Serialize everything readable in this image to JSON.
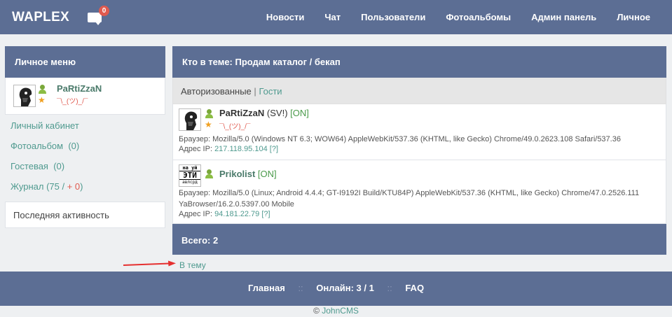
{
  "header": {
    "brand": "WAPLEX",
    "message_badge": "0",
    "nav": [
      "Новости",
      "Чат",
      "Пользователи",
      "Фотоальбомы",
      "Админ панель",
      "Личное"
    ]
  },
  "sidebar": {
    "title": "Личное меню",
    "user": {
      "name": "PaRtiZzaN",
      "status": "¯\\_(ツ)_/¯"
    },
    "menu": {
      "cabinet": "Личный кабинет",
      "photo_label": "Фотоальбом",
      "photo_count": "(0)",
      "guest_label": "Гостевая",
      "guest_count": "(0)",
      "journal_label": "Журнал",
      "journal_total": "(75 /",
      "journal_new": "+ 0",
      "journal_close": ")"
    },
    "last_activity": "Последняя активность"
  },
  "main": {
    "title": "Кто в теме: Продам каталог / бекап",
    "tabs": {
      "active": "Авторизованные",
      "separator": "|",
      "other": "Гости"
    },
    "users": [
      {
        "name": "PaRtiZzaN",
        "role": "(SV!)",
        "online": "[ON]",
        "status": "¯\\_(ツ)_/¯",
        "browser": "Браузер: Mozilla/5.0 (Windows NT 6.3; WOW64) AppleWebKit/537.36 (KHTML, like Gecko) Chrome/49.0.2623.108 Safari/537.36",
        "ip_label": "Адрес IP:",
        "ip": "217.118.95.104",
        "ip_q": "[?]"
      },
      {
        "name": "Prikolist",
        "online": "[ON]",
        "browser": "Браузер: Mozilla/5.0 (Linux; Android 4.4.4; GT-I9192I Build/KTU84P) AppleWebKit/537.36 (KHTML, like Gecko) Chrome/47.0.2526.111 YaBrowser/16.2.0.5397.00 Mobile",
        "ip_label": "Адрес IP:",
        "ip": "94.181.22.79",
        "ip_q": "[?]",
        "avatar_text": [
          "на уй",
          "ЭТИ",
          "авлсрд"
        ]
      }
    ],
    "total": "Всего: 2"
  },
  "back_link": "В тему",
  "footer": {
    "home": "Главная",
    "sep": "::",
    "online": "Онлайн: 3 / 1",
    "faq": "FAQ",
    "copyright_symbol": "©",
    "copyright": "JohnCMS"
  },
  "colors": {
    "accent": "#5c6e94",
    "link": "#4f9a8f",
    "badge": "#e05a4f"
  }
}
